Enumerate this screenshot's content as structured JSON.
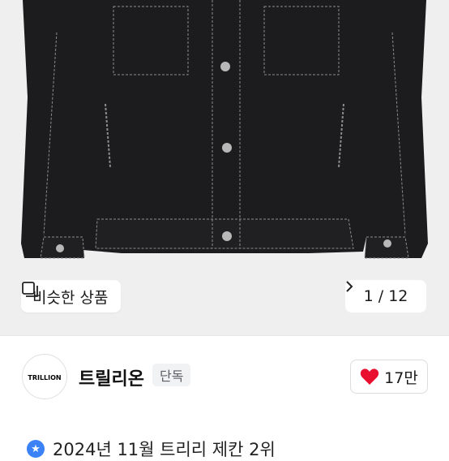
{
  "gallery": {
    "similar_label": "비슷한 상품",
    "counter": "1 / 12",
    "similar_icon": "similar-items-icon",
    "next_icon": "chevron-right-icon"
  },
  "store": {
    "logo_text": "TRILLION",
    "name": "트릴리온",
    "badge": "단독",
    "like_count": "17만",
    "heart_color": "#e8102e"
  },
  "notice": {
    "text": "2024년 11월 트리리 제칸 2위"
  }
}
